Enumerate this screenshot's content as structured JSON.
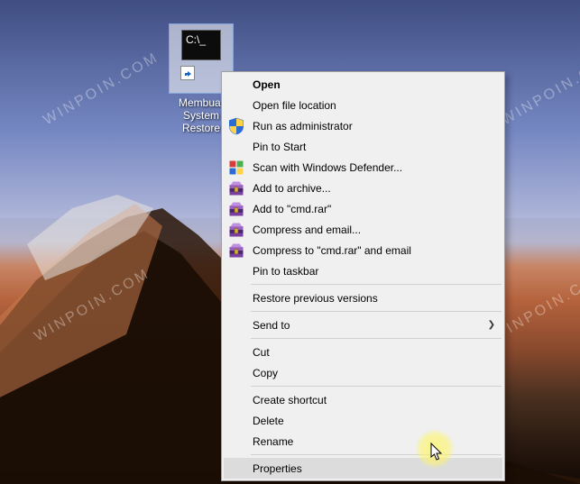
{
  "watermark": "WINPOIN.COM",
  "desktop_icon": {
    "name": "Membuat System Restore",
    "prompt": "C:\\_",
    "shortcut": true
  },
  "context_menu": {
    "items": [
      {
        "id": "open",
        "label": "Open",
        "icon": null,
        "default": true
      },
      {
        "id": "open-location",
        "label": "Open file location",
        "icon": null
      },
      {
        "id": "run-admin",
        "label": "Run as administrator",
        "icon": "shield"
      },
      {
        "id": "pin-start",
        "label": "Pin to Start",
        "icon": null
      },
      {
        "id": "defender",
        "label": "Scan with Windows Defender...",
        "icon": "defender"
      },
      {
        "id": "add-archive",
        "label": "Add to archive...",
        "icon": "winrar"
      },
      {
        "id": "add-cmdrar",
        "label": "Add to \"cmd.rar\"",
        "icon": "winrar"
      },
      {
        "id": "compress-email",
        "label": "Compress and email...",
        "icon": "winrar"
      },
      {
        "id": "compress-cmdrar-email",
        "label": "Compress to \"cmd.rar\" and email",
        "icon": "winrar"
      },
      {
        "id": "pin-taskbar",
        "label": "Pin to taskbar",
        "icon": null
      },
      {
        "type": "separator"
      },
      {
        "id": "restore-versions",
        "label": "Restore previous versions",
        "icon": null
      },
      {
        "type": "separator"
      },
      {
        "id": "send-to",
        "label": "Send to",
        "icon": null,
        "submenu": true
      },
      {
        "type": "separator"
      },
      {
        "id": "cut",
        "label": "Cut",
        "icon": null
      },
      {
        "id": "copy",
        "label": "Copy",
        "icon": null
      },
      {
        "type": "separator"
      },
      {
        "id": "create-shortcut",
        "label": "Create shortcut",
        "icon": null
      },
      {
        "id": "delete",
        "label": "Delete",
        "icon": null
      },
      {
        "id": "rename",
        "label": "Rename",
        "icon": null
      },
      {
        "type": "separator"
      },
      {
        "id": "properties",
        "label": "Properties",
        "icon": null,
        "hover": true
      }
    ],
    "submenu_arrow": "❯"
  }
}
